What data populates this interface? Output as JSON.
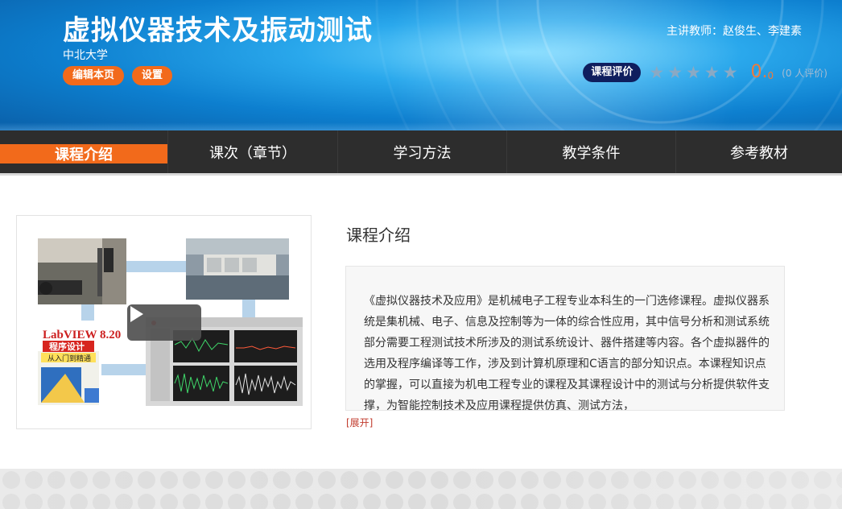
{
  "header": {
    "course_title": "虚拟仪器技术及振动测试",
    "school": "中北大学",
    "edit_page_label": "编辑本页",
    "settings_label": "设置",
    "teacher_text": "主讲教师：赵俊生、李建素",
    "evaluation_label": "课程评价",
    "stars_filled": 0,
    "stars_total": 5,
    "score_main": "0.",
    "score_decimal": "0",
    "rating_count": "(0 人评价)"
  },
  "nav": {
    "tabs": [
      {
        "label": "课程介绍",
        "active": true
      },
      {
        "label": "课次（章节）",
        "active": false
      },
      {
        "label": "学习方法",
        "active": false
      },
      {
        "label": "教学条件",
        "active": false
      },
      {
        "label": "参考教材",
        "active": false
      }
    ]
  },
  "thumbnail": {
    "book_title_line1": "LabVIEW 8.20",
    "book_title_line2": "程序设计",
    "book_title_line3": "从入门到精通",
    "play_icon": "play-icon"
  },
  "main": {
    "section_title": "课程介绍",
    "intro_text": "《虚拟仪器技术及应用》是机械电子工程专业本科生的一门选修课程。虚拟仪器系统是集机械、电子、信息及控制等为一体的综合性应用，其中信号分析和测试系统部分需要工程测试技术所涉及的测试系统设计、器件搭建等内容。各个虚拟器件的选用及程序编译等工作，涉及到计算机原理和C语言的部分知识点。本课程知识点的掌握，可以直接为机电工程专业的课程及其课程设计中的测试与分析提供软件支撑，为智能控制技术及应用课程提供仿真、测试方法，",
    "expand_label": "[展开]"
  },
  "colors": {
    "accent_orange": "#f26a1b",
    "nav_bg": "#2d2d2d",
    "eval_badge": "#0f1e5e",
    "score": "#f07a3a"
  }
}
